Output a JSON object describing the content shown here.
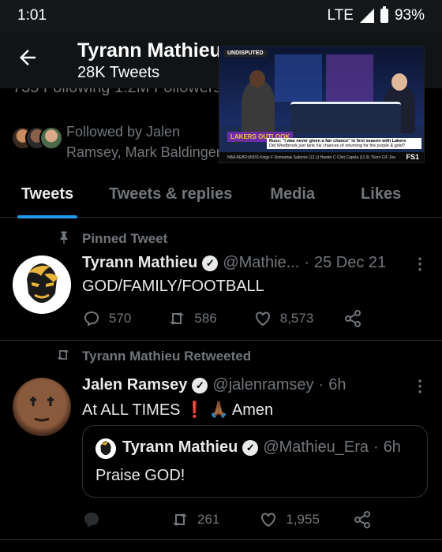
{
  "status_bar": {
    "time": "1:01",
    "network": "LTE",
    "battery": "93%"
  },
  "header": {
    "name": "Tyrann Mathieu",
    "tweet_count": "28K Tweets"
  },
  "profile": {
    "stats_partial": "735 Following   1.2M Followers",
    "followed_by": "Followed by Jalen Ramsey, Mark Baldinger, and 10 others"
  },
  "pip_video": {
    "show_tag": "UNDISPUTED",
    "team_badge": "LAKERS OUTLOOK",
    "ticker": "Russ: \"I was never given a fair chance\" in first season with Lakers",
    "ticker_sub": "Did Westbrook just tank his chances of returning for the purple & gold?",
    "bottom_bar": "NBA   REBOUNDS   Kings F Domantas Sabonis (12.1)   Hawks C Clint Capela (11.9)   76ers C/F Joe",
    "channel": "FS1"
  },
  "tabs": [
    {
      "label": "Tweets",
      "active": true
    },
    {
      "label": "Tweets & replies",
      "active": false
    },
    {
      "label": "Media",
      "active": false
    },
    {
      "label": "Likes",
      "active": false
    }
  ],
  "tweets": [
    {
      "context": "Pinned Tweet",
      "context_icon": "pin-icon",
      "name": "Tyrann Mathieu",
      "handle": "@Mathie...",
      "time": "25 Dec 21",
      "text": "GOD/FAMILY/FOOTBALL",
      "replies": "570",
      "retweets": "586",
      "likes": "8,573"
    },
    {
      "context": "Tyrann Mathieu Retweeted",
      "context_icon": "retweet-icon",
      "name": "Jalen Ramsey",
      "handle": "@jalenramsey",
      "time": "6h",
      "text_main": "At ALL TIMES",
      "text_bang": "❗",
      "text_pray": "🙏🏾",
      "text_end": "Amen",
      "quote": {
        "name": "Tyrann Mathieu",
        "handle": "@Mathieu_Era",
        "time": "6h",
        "text": "Praise GOD!"
      },
      "replies": "",
      "retweets": "261",
      "likes": "1,955"
    }
  ],
  "colors": {
    "accent": "#1d9bf0",
    "muted": "#71767b",
    "background": "#000000"
  }
}
